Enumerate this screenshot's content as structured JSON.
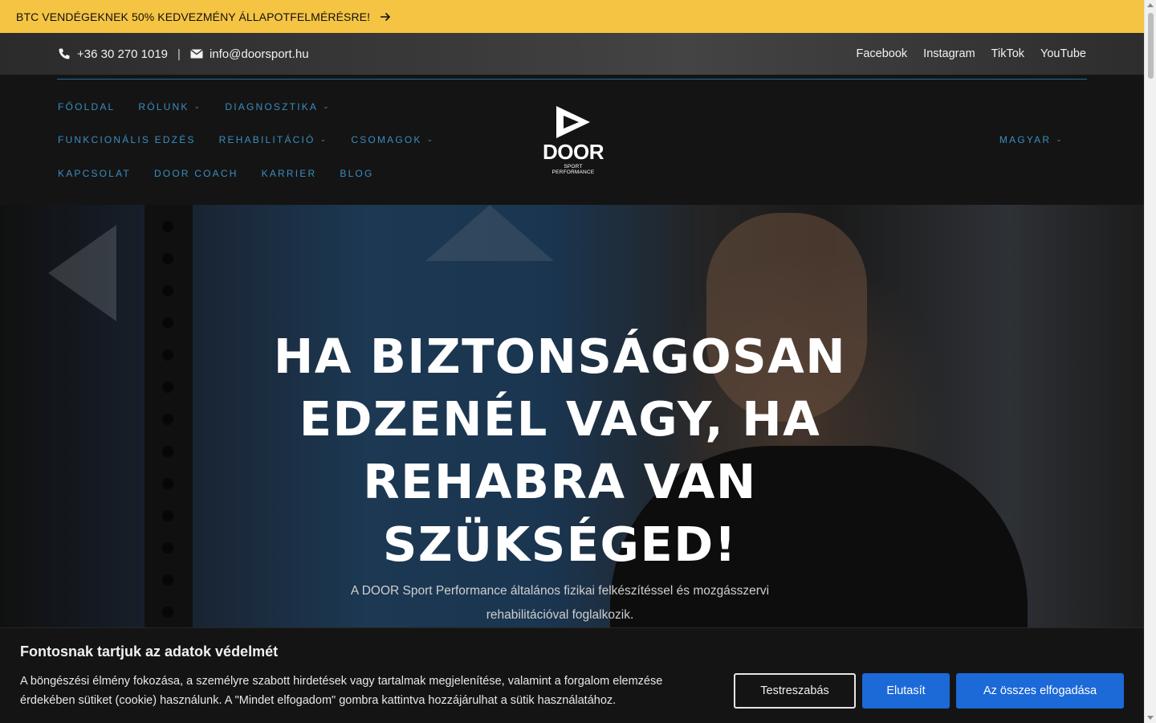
{
  "promo": {
    "text": "BTC VENDÉGEKNEK 50% KEDVEZMÉNY ÁLLAPOTFELMÉRÉSRE!",
    "icon": "arrow-right-icon"
  },
  "contact": {
    "phone": "+36 30 270 1019",
    "separator": "|",
    "email": "info@doorsport.hu"
  },
  "social": {
    "facebook": "Facebook",
    "instagram": "Instagram",
    "tiktok": "TikTok",
    "youtube": "YouTube"
  },
  "nav": {
    "row1": [
      {
        "label": "FŐOLDAL",
        "dropdown": false
      },
      {
        "label": "RÓLUNK",
        "dropdown": true
      },
      {
        "label": "DIAGNOSZTIKA",
        "dropdown": true
      }
    ],
    "row2": [
      {
        "label": "FUNKCIONÁLIS EDZÉS",
        "dropdown": false
      },
      {
        "label": "REHABILITÁCIÓ",
        "dropdown": true
      },
      {
        "label": "CSOMAGOK",
        "dropdown": true
      }
    ],
    "row3": [
      {
        "label": "KAPCSOLAT",
        "dropdown": false
      },
      {
        "label": "DOOR COACH",
        "dropdown": false
      },
      {
        "label": "KARRIER",
        "dropdown": false
      },
      {
        "label": "BLOG",
        "dropdown": false
      }
    ],
    "language": "MAGYAR"
  },
  "logo": {
    "word": "DOOR",
    "sub": "SPORT PERFORMANCE"
  },
  "hero": {
    "title_lines": [
      "HA BIZTONSÁGOSAN",
      "EDZENÉL VAGY, HA",
      "REHABRA VAN",
      "SZÜKSÉGED!"
    ],
    "subtitle_lines": [
      "A DOOR Sport Performance általános fizikai felkészítéssel és mozgásszervi",
      "rehabilitációval foglalkozik."
    ]
  },
  "cookie": {
    "title": "Fontosnak tartjuk az adatok védelmét",
    "text_lines": [
      "A böngészési élmény fokozása, a személyre szabott hirdetések vagy tartalmak megjelenítése, valamint a forgalom elemzése",
      "érdekében sütiket (cookie) használunk. A \"Mindet elfogadom\" gombra kattintva hozzájárulhat a sütik használatához."
    ],
    "customize": "Testreszabás",
    "reject": "Elutasít",
    "accept": "Az összes elfogadása"
  },
  "colors": {
    "promo_bg": "#f5c443",
    "nav_link": "#3a8ec0",
    "button_primary": "#1c69d8",
    "header_bg": "#141414"
  }
}
